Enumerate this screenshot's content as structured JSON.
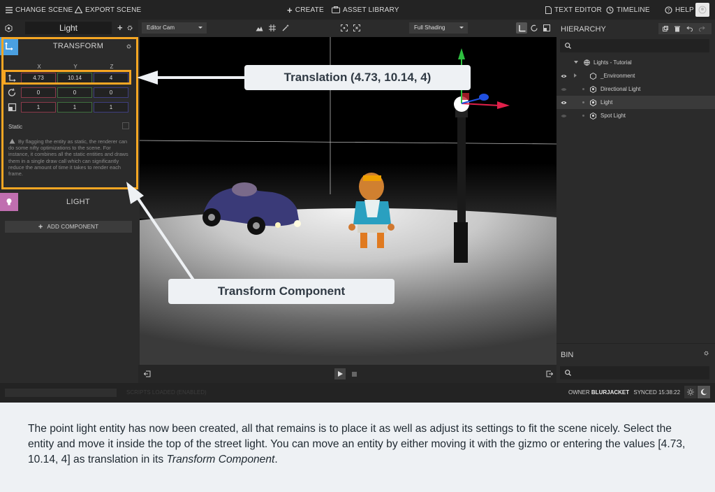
{
  "topbar": {
    "change_scene": "CHANGE SCENE",
    "export_scene": "EXPORT SCENE",
    "create": "CREATE",
    "asset_library": "ASSET LIBRARY",
    "text_editor": "TEXT EDITOR",
    "timeline": "TIMELINE",
    "help": "HELP"
  },
  "inspector": {
    "entity_name": "Light",
    "transform": {
      "title": "TRANSFORM",
      "axes": [
        "X",
        "Y",
        "Z"
      ],
      "translation": [
        "4.73",
        "10.14",
        "4"
      ],
      "rotation": [
        "0",
        "0",
        "0"
      ],
      "scale": [
        "1",
        "1",
        "1"
      ],
      "static_label": "Static",
      "note": "By flagging the entity as static, the renderer can do some nifty optimizations to the scene. For instance, it combines all the static entities and draws them in a single draw call which can significantly reduce the amount of time it takes to render each frame."
    },
    "light_title": "LIGHT",
    "add_component": "ADD COMPONENT"
  },
  "viewport": {
    "camera": "Editor Cam",
    "shading": "Full Shading"
  },
  "hierarchy": {
    "title": "HIERARCHY",
    "root": "Lights - Tutorial",
    "items": [
      "_Environment",
      "Directional Light",
      "Light",
      "Spot Light"
    ],
    "selected": "Light"
  },
  "bin": {
    "title": "BIN"
  },
  "status": {
    "loaded": "SCRIPTS LOADED (ENABLED)",
    "owner_label": "OWNER",
    "owner": "BLURJACKET",
    "synced": "SYNCED 15:38:22"
  },
  "annotations": {
    "translation_callout": "Translation (4.73, 10.14, 4)",
    "transform_callout": "Transform Component"
  },
  "caption": {
    "main": "The point light entity has now been created, all that remains is to place it as well as adjust its settings to fit the scene nicely. Select the entity and move it inside the top of the street light. You can move an entity by either moving it with the gizmo or entering the values [4.73, 10.14, 4] as translation in its ",
    "emphasis": "Transform Component",
    "end": "."
  },
  "colors": {
    "highlight": "#f5a623",
    "transform_icon_bg": "#4a9fe0",
    "light_icon_bg": "#c06fb0",
    "gizmo_x": "#e0204a",
    "gizmo_y": "#2ec040",
    "gizmo_z": "#2050e0"
  }
}
